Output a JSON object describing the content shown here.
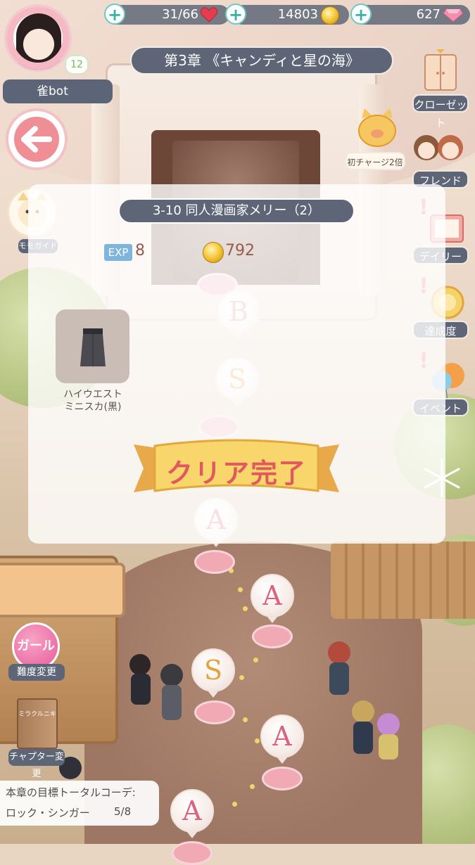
{
  "player": {
    "name": "雀bot",
    "level": "12"
  },
  "resources": {
    "stamina": "31/66",
    "coins": "14803",
    "diamonds": "627"
  },
  "chapter_title": "第3章 《キャンディと星の海》",
  "menu": {
    "closet": "クローゼット",
    "first_charge": "初チャージ2倍",
    "friend": "フレンド",
    "daily": "デイリー",
    "achievement": "達成度",
    "event": "イベント"
  },
  "guide_label": "モモガイド",
  "result": {
    "stage_title": "3-10 同人漫画家メリー（2）",
    "exp_label": "EXP",
    "exp_value": "8",
    "coin_value": "792",
    "reward_item": "ハイウエスト\nミニスカ(黒)",
    "clear_text": "クリア完了"
  },
  "stage_nodes": [
    {
      "grade": "B",
      "color": "#d98a8a"
    },
    {
      "grade": "S",
      "color": "#e5a23a"
    },
    {
      "grade": "A",
      "color": "#d9627e"
    },
    {
      "grade": "A",
      "color": "#d9627e"
    },
    {
      "grade": "S",
      "color": "#e5a23a"
    },
    {
      "grade": "A",
      "color": "#d9627e"
    },
    {
      "grade": "A",
      "color": "#d9627e"
    }
  ],
  "difficulty": {
    "mode": "ガール",
    "label": "難度変更"
  },
  "chapter_change": {
    "book_title": "ミラクルニキ",
    "label": "チャプター変更"
  },
  "goal": {
    "line1": "本章の目標トータルコーデ:",
    "theme": "ロック・シンガー",
    "progress": "5/8"
  },
  "colors": {
    "accent_pink": "#ef8e94",
    "label_bg": "#5d6577",
    "plus_teal": "#38b1a7"
  }
}
